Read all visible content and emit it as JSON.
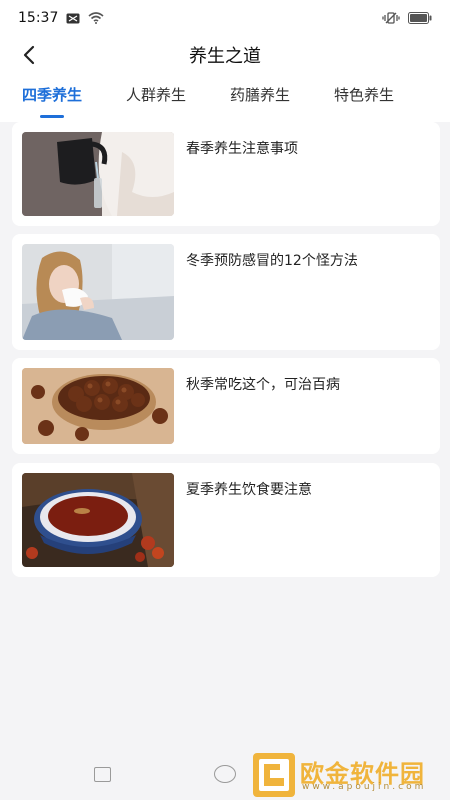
{
  "status": {
    "time": "15:37"
  },
  "header": {
    "title": "养生之道"
  },
  "tabs": [
    {
      "label": "四季养生",
      "active": true
    },
    {
      "label": "人群养生",
      "active": false
    },
    {
      "label": "药膳养生",
      "active": false
    },
    {
      "label": "特色养生",
      "active": false
    }
  ],
  "articles": [
    {
      "title": "春季养生注意事项",
      "image": "kettle-pouring-water-photo"
    },
    {
      "title": "冬季预防感冒的12个怪方法",
      "image": "woman-with-tissue-photo"
    },
    {
      "title": "秋季常吃这个，可治百病",
      "image": "chestnuts-in-bowl-photo"
    },
    {
      "title": "夏季养生饮食要注意",
      "image": "herbal-tea-bowl-photo"
    }
  ],
  "watermark": {
    "brand": "欧金软件园",
    "url": "www.apoujin.com"
  },
  "colors": {
    "accent": "#1e6fd9",
    "background": "#f4f4f6",
    "card": "#ffffff",
    "watermark": "#f0b43c"
  }
}
